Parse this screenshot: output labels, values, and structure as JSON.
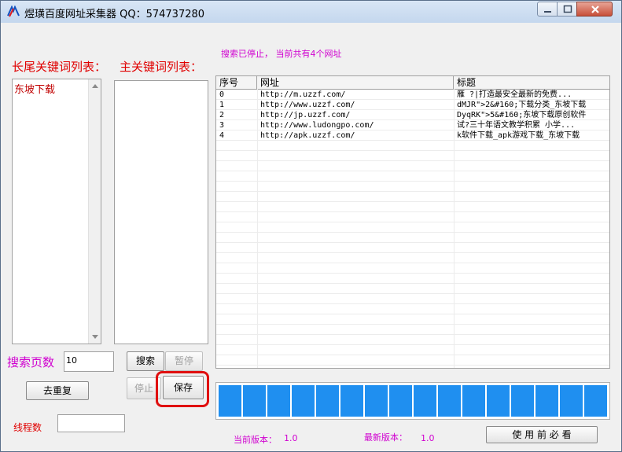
{
  "window": {
    "title": "煜璜百度网址采集器   QQ：574737280"
  },
  "status": "搜索已停止，  当前共有4个网址",
  "left_panel": {
    "tail_keywords_label": "长尾关键词列表：",
    "main_keywords_label": "主关键词列表：",
    "tail_keywords": [
      "东坡下载"
    ],
    "search_pages_label": "搜索页数",
    "search_pages_value": "10",
    "dedupe_button": "去重复",
    "threads_label": "线程数",
    "threads_value": ""
  },
  "buttons": {
    "search": "搜索",
    "pause": "暂停",
    "stop": "停止",
    "save": "保存",
    "must_read": "使 用 前 必 看"
  },
  "table": {
    "columns": [
      "序号",
      "网址",
      "标题"
    ],
    "rows": [
      {
        "index": "0",
        "url": "http://m.uzzf.com/",
        "title": "雁  ?|打造最安全最新的免费..."
      },
      {
        "index": "1",
        "url": "http://www.uzzf.com/",
        "title": "dMJR\">2&#160;下载分类_东坡下载"
      },
      {
        "index": "2",
        "url": "http://jp.uzzf.com/",
        "title": "DyqRK\">5&#160;东坡下载原创软件"
      },
      {
        "index": "3",
        "url": "http://www.ludongpo.com/",
        "title": "试?三十年语文教学积累 小学..."
      },
      {
        "index": "4",
        "url": "http://apk.uzzf.com/",
        "title": "k软件下载_apk游戏下载_东坡下载"
      }
    ]
  },
  "progress": {
    "fraction": 1.0,
    "segments": 16,
    "color": "#1f8ff0"
  },
  "footer": {
    "current_version_label": "当前版本：",
    "current_version": "1.0",
    "latest_version_label": "最新版本：",
    "latest_version": "1.0"
  },
  "icons": {
    "app": "app-logo-icon",
    "minimize": "minimize-icon",
    "maximize": "maximize-icon",
    "close": "close-icon"
  }
}
